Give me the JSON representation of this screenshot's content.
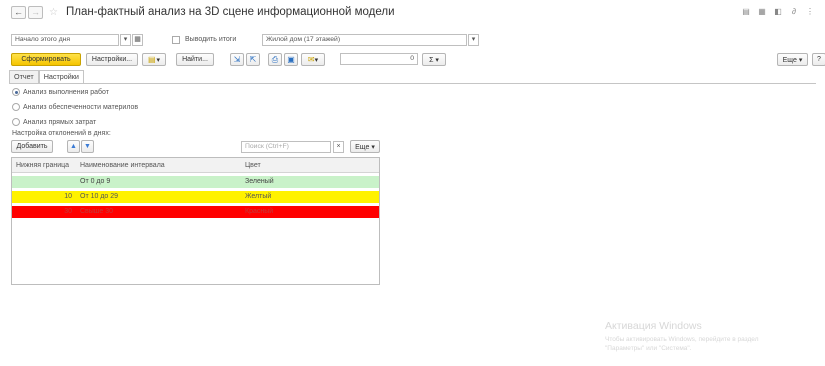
{
  "window": {
    "title": "План-фактный анализ на 3D сцене информационной модели",
    "back": "←",
    "forward": "→",
    "star": "☆",
    "icons": [
      "print-icon",
      "save-icon",
      "ref-icon",
      "link-icon",
      "more-icon"
    ],
    "icon_glyphs": [
      "▤",
      "▦",
      "◧",
      "∂",
      "⋮"
    ]
  },
  "filters": {
    "period": "Начало этого дня",
    "period_dropdown": "▾",
    "period_calendar": "▦",
    "totals_label": "Выводить итоги",
    "building": "Жилой дом (17 этажей)",
    "building_dropdown": "▾"
  },
  "toolbar": {
    "generate": "Сформировать",
    "settings": "Настройки...",
    "variant": "▾",
    "find": "Найти...",
    "number_value": "0",
    "sum": "Σ ▾",
    "more": "Еще ▾",
    "help": "?"
  },
  "tabs": [
    "Отчет",
    "Настройки"
  ],
  "analysis_options": [
    {
      "label": "Анализ выполнения работ",
      "checked": true
    },
    {
      "label": "Анализ обеспеченности материлов",
      "checked": false
    },
    {
      "label": "Анализ прямых затрат",
      "checked": false
    }
  ],
  "deviation": {
    "caption": "Настройка отклонений в днях:",
    "add": "Добавить",
    "up": "▲",
    "down": "▼",
    "search_placeholder": "Поиск (Ctrl+F)",
    "clear": "×",
    "more": "Еще ▾",
    "columns": [
      "Нижняя граница",
      "Наименование интервала",
      "Цвет"
    ],
    "rows": [
      {
        "lower": "",
        "name": "От 0 до 9",
        "color": "Зеленый",
        "bg": "#c9f2c9"
      },
      {
        "lower": "10",
        "name": "От 10 до 29",
        "color": "Желтый",
        "bg": "#fff200"
      },
      {
        "lower": "30",
        "name": "Свыше 30",
        "color": "Красный",
        "bg": "#ff0000"
      }
    ]
  },
  "watermark": {
    "line1": "Активация Windows",
    "line2": "Чтобы активировать Windows, перейдите в раздел",
    "line3": "\"Параметры\" или \"Система\"."
  }
}
